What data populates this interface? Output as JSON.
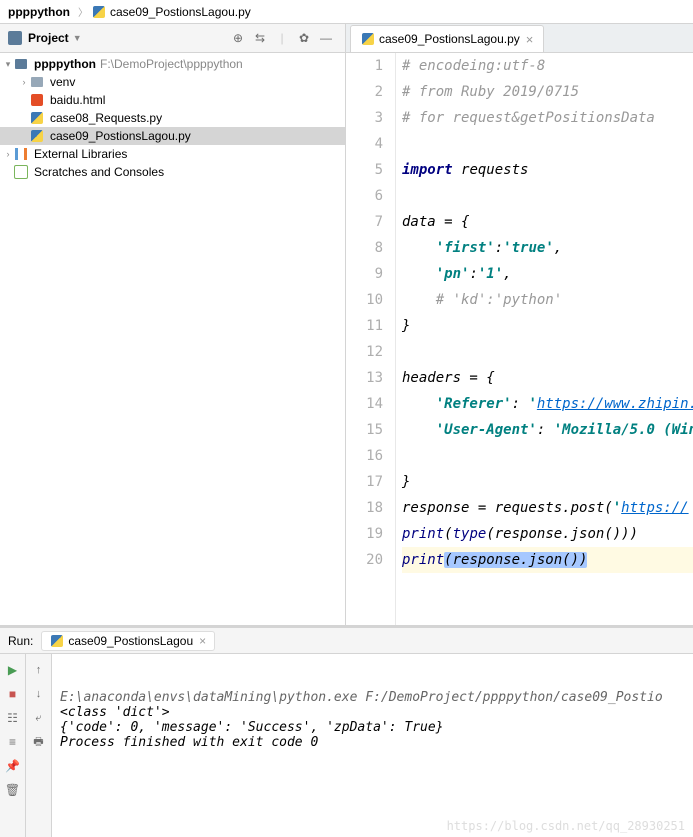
{
  "breadcrumb": {
    "root": "ppppython",
    "file": "case09_PostionsLagou.py"
  },
  "sidebar": {
    "title": "Project",
    "tree": {
      "root": {
        "name": "ppppython",
        "path": "F:\\DemoProject\\ppppython"
      },
      "venv": "venv",
      "files": [
        "baidu.html",
        "case08_Requests.py",
        "case09_PostionsLagou.py"
      ],
      "ext_lib": "External Libraries",
      "scratch": "Scratches and Consoles"
    }
  },
  "editor": {
    "tab": "case09_PostionsLagou.py",
    "lines": [
      {
        "n": 1,
        "seg": [
          [
            "comment",
            "# encodeing:utf-8"
          ]
        ]
      },
      {
        "n": 2,
        "seg": [
          [
            "comment",
            "# from Ruby 2019/0715"
          ]
        ]
      },
      {
        "n": 3,
        "seg": [
          [
            "comment",
            "# for request&getPositionsData"
          ]
        ]
      },
      {
        "n": 4,
        "seg": []
      },
      {
        "n": 5,
        "seg": [
          [
            "kw",
            "import "
          ],
          [
            "plain",
            "requests"
          ]
        ]
      },
      {
        "n": 6,
        "seg": []
      },
      {
        "n": 7,
        "seg": [
          [
            "plain",
            "data = {"
          ]
        ]
      },
      {
        "n": 8,
        "seg": [
          [
            "plain",
            "    "
          ],
          [
            "str",
            "'first'"
          ],
          [
            "plain",
            ":"
          ],
          [
            "str",
            "'true'"
          ],
          [
            "plain",
            ","
          ]
        ]
      },
      {
        "n": 9,
        "seg": [
          [
            "plain",
            "    "
          ],
          [
            "str",
            "'pn'"
          ],
          [
            "plain",
            ":"
          ],
          [
            "str",
            "'1'"
          ],
          [
            "plain",
            ","
          ]
        ]
      },
      {
        "n": 10,
        "seg": [
          [
            "plain",
            "    "
          ],
          [
            "comment",
            "# 'kd':'python'"
          ]
        ]
      },
      {
        "n": 11,
        "seg": [
          [
            "plain",
            "}"
          ]
        ]
      },
      {
        "n": 12,
        "seg": []
      },
      {
        "n": 13,
        "seg": [
          [
            "plain",
            "headers = {"
          ]
        ]
      },
      {
        "n": 14,
        "seg": [
          [
            "plain",
            "    "
          ],
          [
            "str",
            "'Referer'"
          ],
          [
            "plain",
            ": "
          ],
          [
            "str",
            "'"
          ],
          [
            "link",
            "https://www.zhipin."
          ]
        ]
      },
      {
        "n": 15,
        "seg": [
          [
            "plain",
            "    "
          ],
          [
            "str",
            "'User-Agent'"
          ],
          [
            "plain",
            ": "
          ],
          [
            "str",
            "'Mozilla/5.0 (Win"
          ]
        ]
      },
      {
        "n": 16,
        "seg": []
      },
      {
        "n": 17,
        "seg": [
          [
            "plain",
            "}"
          ]
        ]
      },
      {
        "n": 18,
        "seg": [
          [
            "plain",
            "response = requests.post("
          ],
          [
            "str",
            "'"
          ],
          [
            "link",
            "https://"
          ]
        ]
      },
      {
        "n": 19,
        "seg": [
          [
            "builtin",
            "print"
          ],
          [
            "plain",
            "("
          ],
          [
            "builtin",
            "type"
          ],
          [
            "plain",
            "(response.json()))"
          ]
        ]
      },
      {
        "n": 20,
        "hl": true,
        "seg": [
          [
            "builtin",
            "print"
          ],
          [
            "sel",
            "(response.json())"
          ]
        ]
      }
    ]
  },
  "run": {
    "title": "Run:",
    "tab": "case09_PostionsLagou",
    "lines": [
      {
        "cls": "cmd",
        "t": "E:\\anaconda\\envs\\dataMining\\python.exe F:/DemoProject/ppppython/case09_Postio"
      },
      {
        "cls": "out",
        "t": "<class 'dict'>"
      },
      {
        "cls": "out",
        "t": "{'code': 0, 'message': 'Success', 'zpData': True}"
      },
      {
        "cls": "out",
        "t": ""
      },
      {
        "cls": "exit",
        "t": "Process finished with exit code 0"
      }
    ],
    "watermark": "https://blog.csdn.net/qq_28930251"
  }
}
